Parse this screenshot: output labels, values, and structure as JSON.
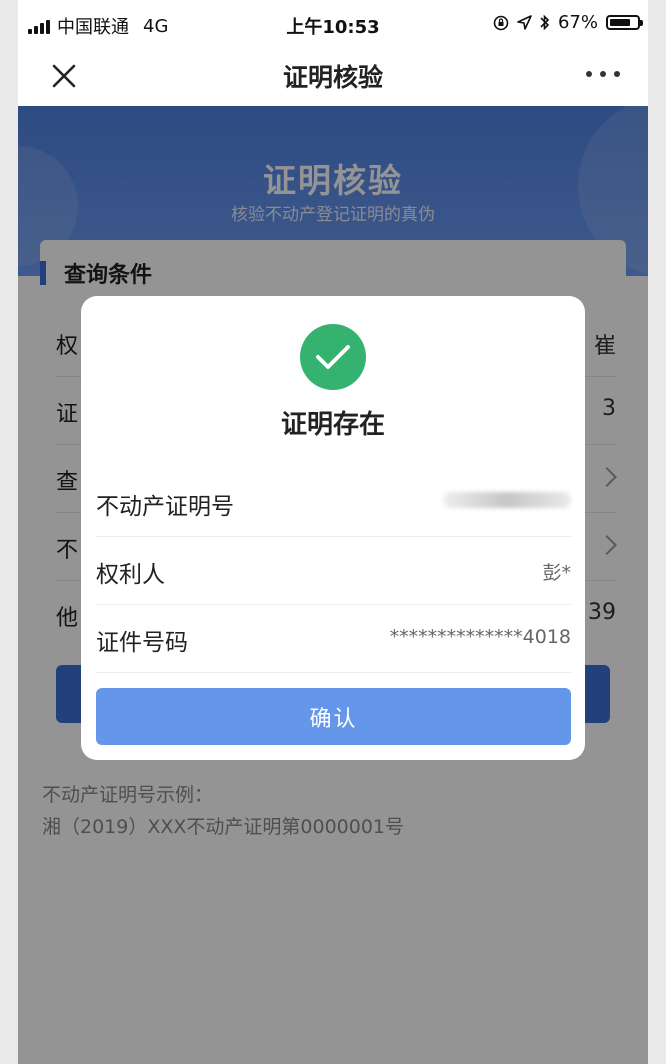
{
  "status_bar": {
    "carrier": "中国联通",
    "network": "4G",
    "time": "上午10:53",
    "battery": "67%",
    "battery_level": 0.67
  },
  "nav": {
    "title": "证明核验",
    "close_icon": "close-icon",
    "more_icon": "more-dots-icon"
  },
  "hero": {
    "title": "证明核验",
    "subtitle": "核验不动产登记证明的真伪"
  },
  "query_card": {
    "heading": "查询条件",
    "rows": [
      {
        "label_partial": "权",
        "value_partial": "崔"
      },
      {
        "label_partial": "证",
        "value_partial": "3"
      },
      {
        "label_partial": "查",
        "value_partial": ""
      },
      {
        "label_partial": "不",
        "value_partial": ""
      },
      {
        "label_partial": "他",
        "value_partial": "39"
      }
    ]
  },
  "example": {
    "label": "不动产证明号示例：",
    "text": "湘（2019）XXX不动产证明第0000001号"
  },
  "dialog": {
    "title": "证明存在",
    "rows": [
      {
        "label": "不动产证明号",
        "value": ""
      },
      {
        "label": "权利人",
        "value": "彭*"
      },
      {
        "label": "证件号码",
        "value": "**************4018"
      }
    ],
    "confirm_label": "确认",
    "accent_color": "#35b170",
    "button_color": "#6497ea"
  }
}
